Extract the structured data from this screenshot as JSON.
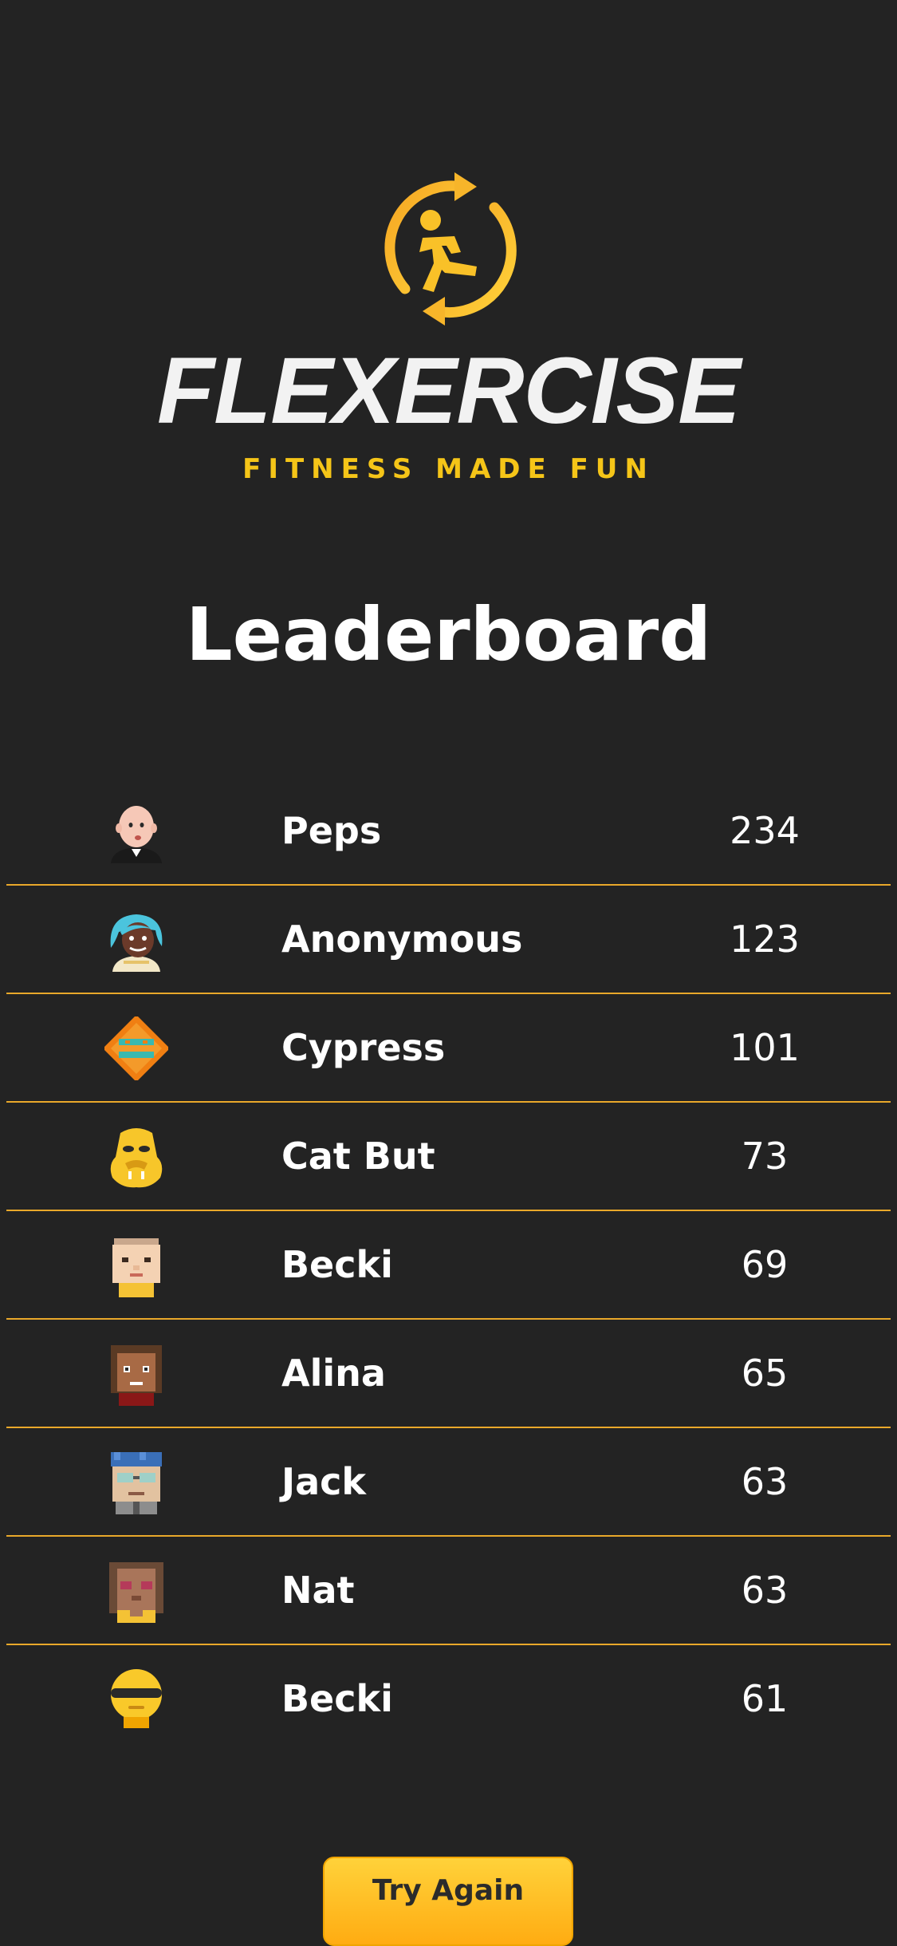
{
  "brand": {
    "name": "FLEXERCISE",
    "tagline": "FITNESS MADE FUN",
    "accent_color": "#f5c518",
    "logo_icon": "running-figure-refresh-icon"
  },
  "page": {
    "title": "Leaderboard"
  },
  "leaderboard": [
    {
      "name": "Peps",
      "score": "234",
      "avatar": "bald-man-avatar-icon"
    },
    {
      "name": "Anonymous",
      "score": "123",
      "avatar": "blue-hair-avatar-icon"
    },
    {
      "name": "Cypress",
      "score": "101",
      "avatar": "orange-diamond-avatar-icon"
    },
    {
      "name": "Cat But",
      "score": "73",
      "avatar": "yellow-mask-avatar-icon"
    },
    {
      "name": "Becki",
      "score": "69",
      "avatar": "pixel-face-avatar-icon"
    },
    {
      "name": "Alina",
      "score": "65",
      "avatar": "pixel-brown-hair-avatar-icon"
    },
    {
      "name": "Jack",
      "score": "63",
      "avatar": "pixel-glasses-avatar-icon"
    },
    {
      "name": "Nat",
      "score": "63",
      "avatar": "pixel-heart-eyes-avatar-icon"
    },
    {
      "name": "Becki",
      "score": "61",
      "avatar": "yellow-visor-avatar-icon"
    }
  ],
  "actions": {
    "try_again_label": "Try Again"
  },
  "colors": {
    "background": "#232323",
    "divider": "#e9a82a",
    "button": "#ffc125"
  }
}
